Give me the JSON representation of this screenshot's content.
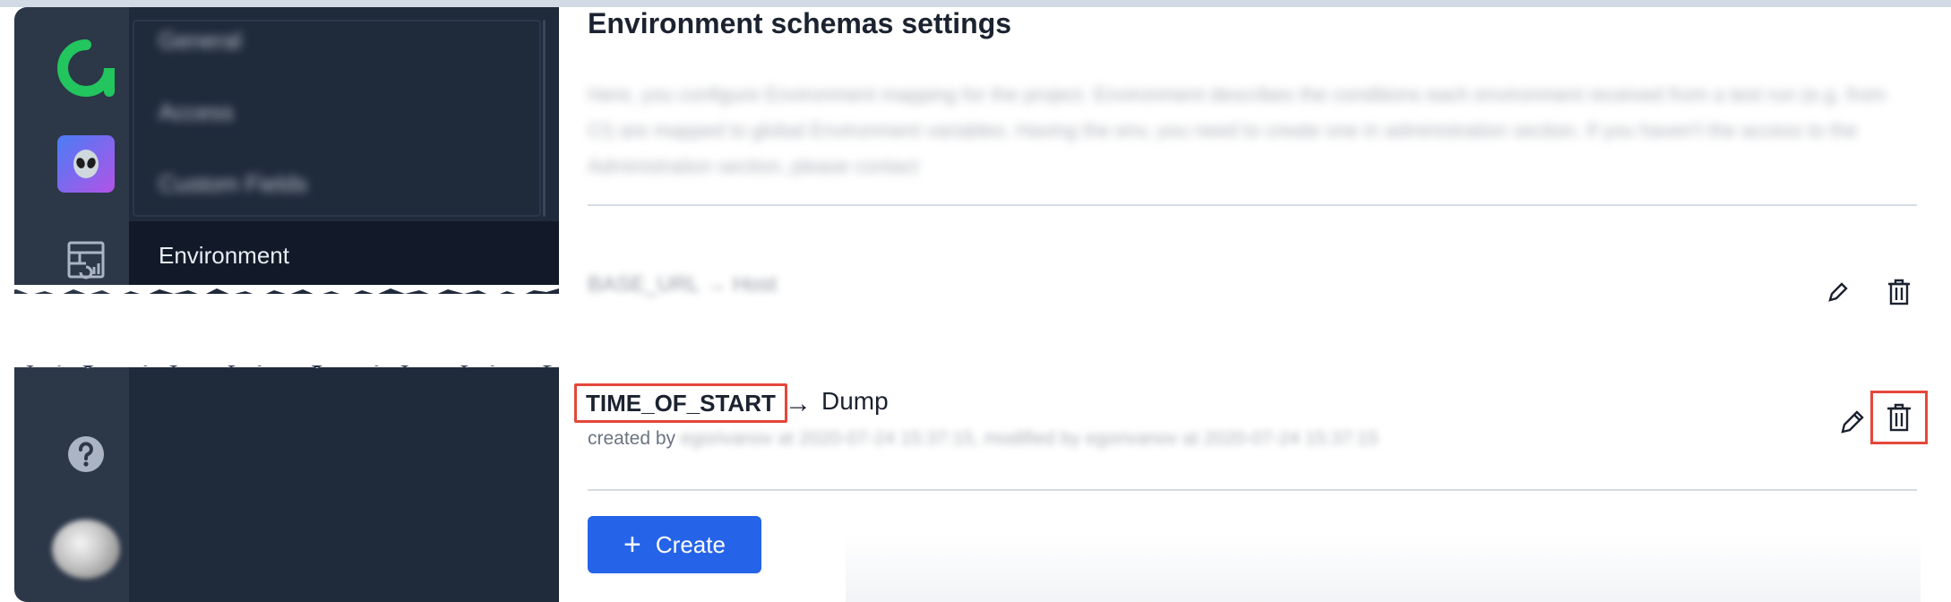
{
  "page": {
    "title": "Environment schemas settings",
    "description": "Here, you configure Environment mapping for the project. Environment describes the conditions each environment received from a test run (e.g. from CI) are mapped to global Environment variables. Having the env, you need to create one in administration section. If you haven't the access to the Administration section, please contact"
  },
  "sidebar": {
    "items": [
      {
        "label": "General"
      },
      {
        "label": "Access"
      },
      {
        "label": "Custom Fields"
      },
      {
        "label": "Environment"
      }
    ]
  },
  "rail": {
    "icons": [
      "logo-icon",
      "project-avatar",
      "dashboard-icon",
      "help-icon",
      "user-avatar"
    ]
  },
  "mappings": [
    {
      "name": "BASE_URL",
      "arrow": "→",
      "target": "Host"
    },
    {
      "name": "TIME_OF_START",
      "arrow": "→",
      "target": "Dump",
      "created_label": "created by",
      "meta_rest": "egorivanov at 2020-07-24 15:37:15, modified by egorivanov at 2020-07-24 15:37:15"
    }
  ],
  "actions": {
    "create_label": "Create",
    "create_icon": "+"
  },
  "colors": {
    "accent": "#2563e8",
    "highlight": "#e5473a",
    "sidebar_bg": "#1f2a3b",
    "rail_bg": "#2c3748"
  }
}
